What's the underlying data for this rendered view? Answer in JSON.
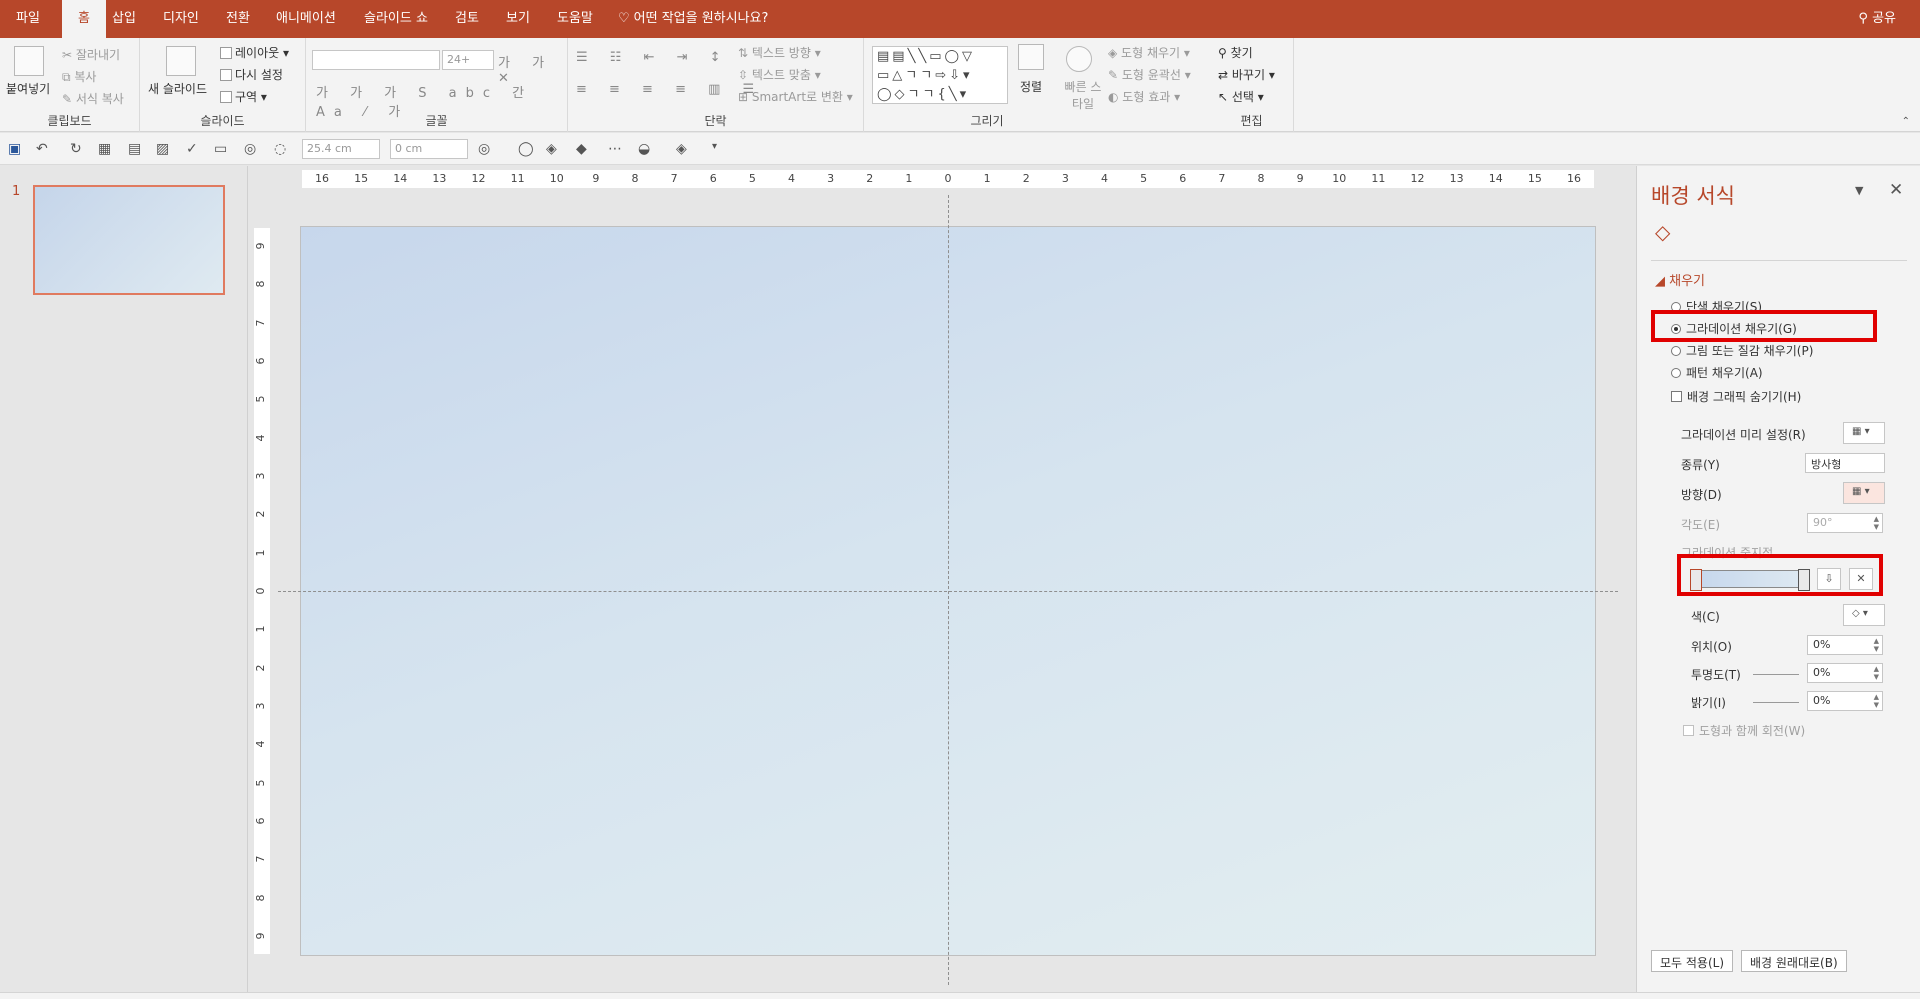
{
  "tabs": [
    {
      "label": "파일",
      "active": false
    },
    {
      "label": "홈",
      "active": true
    },
    {
      "label": "삽입",
      "active": false
    },
    {
      "label": "디자인",
      "active": false
    },
    {
      "label": "전환",
      "active": false
    },
    {
      "label": "애니메이션",
      "active": false
    },
    {
      "label": "슬라이드 쇼",
      "active": false
    },
    {
      "label": "검토",
      "active": false
    },
    {
      "label": "보기",
      "active": false
    },
    {
      "label": "도움말",
      "active": false
    }
  ],
  "tell_me": "어떤 작업을 원하시나요?",
  "share": "공유",
  "ribbon": {
    "clipboard": {
      "paste": "붙여넣기",
      "cut": "잘라내기",
      "copy": "복사",
      "format_painter": "서식 복사",
      "label": "클립보드"
    },
    "slides": {
      "new_slide": "새 슬라이드",
      "layout": "레이아웃",
      "reset": "다시 설정",
      "section": "구역",
      "label": "슬라이드"
    },
    "font": {
      "label": "글꼴",
      "font_size": "24+"
    },
    "paragraph": {
      "text_direction": "텍스트 방향",
      "align_text": "텍스트 맞춤",
      "smartart": "SmartArt로 변환",
      "label": "단락"
    },
    "drawing": {
      "arrange": "정렬",
      "quick_styles": "빠른 스타일",
      "shape_fill": "도형 채우기",
      "shape_outline": "도형 윤곽선",
      "shape_effects": "도형 효과",
      "label": "그리기"
    },
    "editing": {
      "find": "찾기",
      "replace": "바꾸기",
      "select": "선택",
      "label": "편집"
    }
  },
  "qat": {
    "width": "25.4 cm",
    "height": "0 cm"
  },
  "thumbnails": [
    {
      "number": "1"
    }
  ],
  "ruler": {
    "h": [
      "16",
      "15",
      "14",
      "13",
      "12",
      "11",
      "10",
      "9",
      "8",
      "7",
      "6",
      "5",
      "4",
      "3",
      "2",
      "1",
      "0",
      "1",
      "2",
      "3",
      "4",
      "5",
      "6",
      "7",
      "8",
      "9",
      "10",
      "11",
      "12",
      "13",
      "14",
      "15",
      "16"
    ],
    "v": [
      "9",
      "8",
      "7",
      "6",
      "5",
      "4",
      "3",
      "2",
      "1",
      "0",
      "1",
      "2",
      "3",
      "4",
      "5",
      "6",
      "7",
      "8",
      "9"
    ]
  },
  "format_pane": {
    "title": "배경 서식",
    "section": "채우기",
    "fill_options": [
      {
        "label": "단색 채우기(S)",
        "selected": false
      },
      {
        "label": "그라데이션 채우기(G)",
        "selected": true
      },
      {
        "label": "그림 또는 질감 채우기(P)",
        "selected": false
      },
      {
        "label": "패턴 채우기(A)",
        "selected": false
      }
    ],
    "hide_graphics": "배경 그래픽 숨기기(H)",
    "preset_label": "그라데이션 미리 설정(R)",
    "type_label": "종류(Y)",
    "type_value": "방사형",
    "direction_label": "방향(D)",
    "angle_label": "각도(E)",
    "angle_value": "90°",
    "stops_label": "그라데이션 중지점",
    "color_label": "색(C)",
    "position_label": "위치(O)",
    "position_value": "0%",
    "transparency_label": "투명도(T)",
    "transparency_value": "0%",
    "brightness_label": "밝기(I)",
    "brightness_value": "0%",
    "rotate_label": "도형과 함께 회전(W)",
    "apply_all": "모두 적용(L)",
    "reset_background": "배경 원래대로(B)"
  },
  "colors": {
    "accent": "#b7472a",
    "highlight": "#e00000"
  }
}
